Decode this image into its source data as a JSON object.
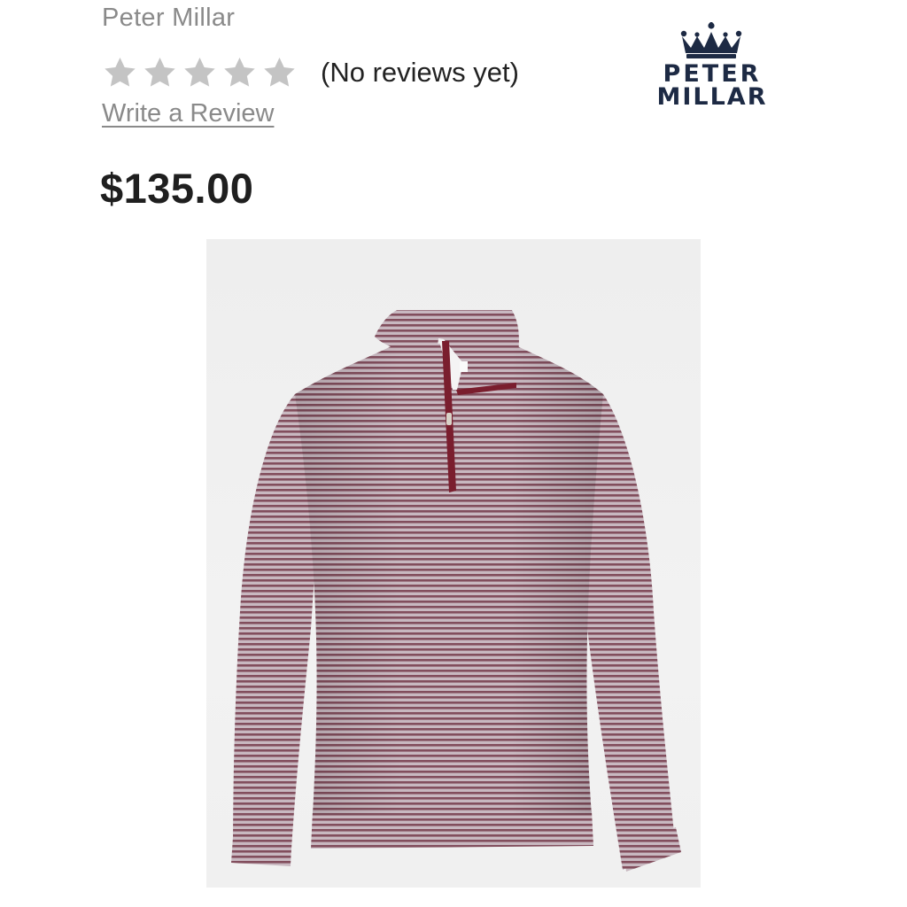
{
  "product": {
    "brand": "Peter Millar",
    "rating": {
      "stars_filled": 0,
      "stars_total": 5,
      "review_text": "(No reviews yet)",
      "write_review_label": "Write a Review"
    },
    "price": "$135.00",
    "image": {
      "description_icon": "quarter-zip-pullover-image",
      "garment_color": "#a58c96",
      "stripe_color": "#6b2a3c",
      "zip_color": "#7a1e2e"
    }
  },
  "logo": {
    "line1": "PETER",
    "line2": "MILLAR",
    "color": "#1d2a44",
    "icon": "crown-icon"
  },
  "colors": {
    "star_empty": "#c4c4c4",
    "muted_text": "#8a8a8a",
    "price_text": "#1f1f1f"
  }
}
